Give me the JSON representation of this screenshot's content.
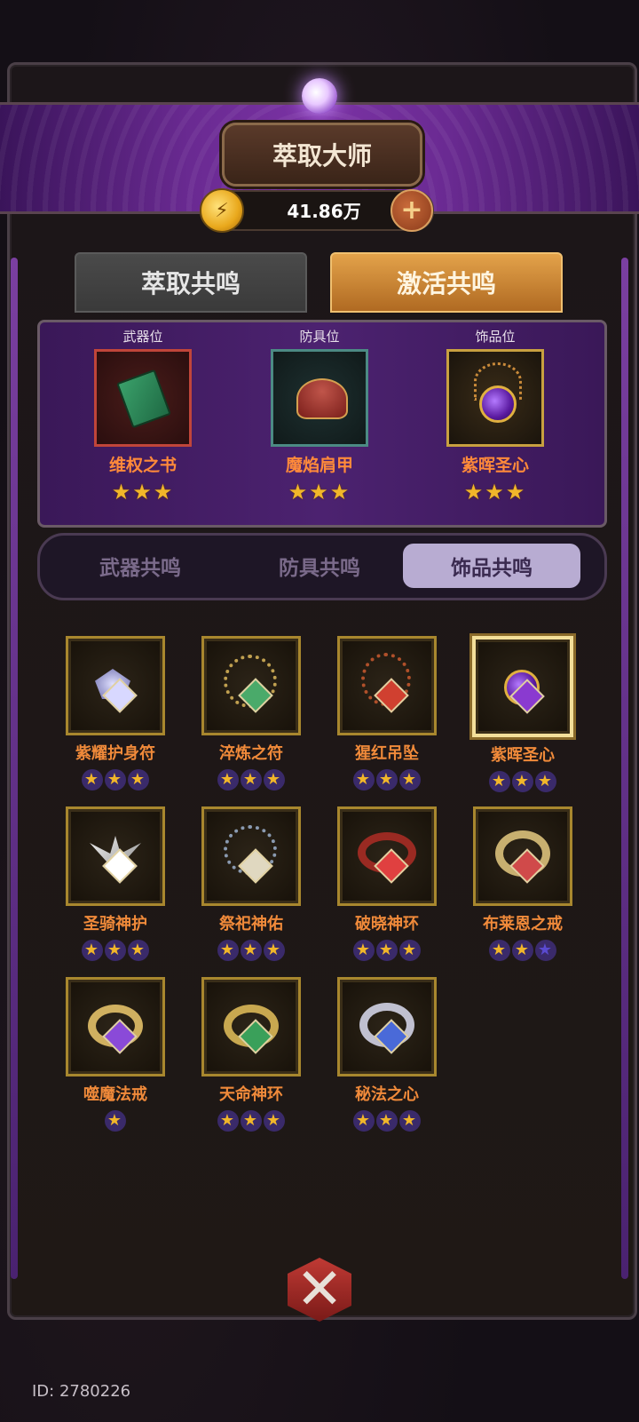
{
  "header": {
    "title": "萃取大师",
    "currency_value": "41.86万",
    "plus_label": "+"
  },
  "main_tabs": [
    {
      "label": "萃取共鸣",
      "active": false
    },
    {
      "label": "激活共鸣",
      "active": true
    }
  ],
  "slots": [
    {
      "label": "武器位",
      "item": "维权之书",
      "stars": "★★★"
    },
    {
      "label": "防具位",
      "item": "魔焰肩甲",
      "stars": "★★★"
    },
    {
      "label": "饰品位",
      "item": "紫晖圣心",
      "stars": "★★★"
    }
  ],
  "sub_tabs": [
    {
      "label": "武器共鸣",
      "active": false
    },
    {
      "label": "防具共鸣",
      "active": false
    },
    {
      "label": "饰品共鸣",
      "active": true
    }
  ],
  "items": [
    {
      "name": "紫耀护身符",
      "stars": 3,
      "max": 3
    },
    {
      "name": "淬炼之符",
      "stars": 3,
      "max": 3
    },
    {
      "name": "猩红吊坠",
      "stars": 3,
      "max": 3
    },
    {
      "name": "紫晖圣心",
      "stars": 3,
      "max": 3,
      "selected": true
    },
    {
      "name": "圣骑神护",
      "stars": 3,
      "max": 3
    },
    {
      "name": "祭祀神佑",
      "stars": 3,
      "max": 3
    },
    {
      "name": "破晓神环",
      "stars": 3,
      "max": 3
    },
    {
      "name": "布莱恩之戒",
      "stars": 2,
      "max": 3
    },
    {
      "name": "噬魔法戒",
      "stars": 1,
      "max": 1
    },
    {
      "name": "天命神环",
      "stars": 3,
      "max": 3
    },
    {
      "name": "秘法之心",
      "stars": 3,
      "max": 3
    }
  ],
  "footer": {
    "player_id": "ID: 2780226",
    "close_symbol": "✕"
  },
  "colors": {
    "accent_orange": "#f08a3a",
    "star_gold": "#f1b62a",
    "banner_purple": "#6a2a92"
  }
}
